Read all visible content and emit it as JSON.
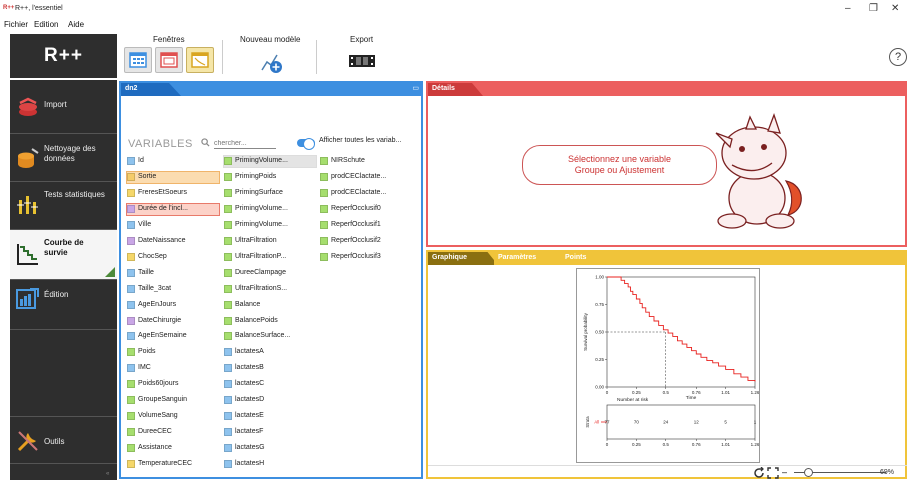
{
  "window": {
    "app_badge": "R++",
    "title": "R++, l'essentiel",
    "minimize": "–",
    "maximize": "❐",
    "close": "✕"
  },
  "menu": {
    "items": [
      "Fichier",
      "Edition",
      "Aide"
    ]
  },
  "ribbon": {
    "logo": "R++",
    "groups": {
      "fenetres": "Fenêtres",
      "nouveau_modele": "Nouveau modèle",
      "export": "Export"
    },
    "help": "?"
  },
  "sidebar": {
    "items": [
      {
        "label": "Import",
        "icon": "import-icon"
      },
      {
        "label": "Nettoyage des données",
        "icon": "cleaning-icon"
      },
      {
        "label": "Tests statistiques",
        "icon": "tests-icon"
      },
      {
        "label": "Courbe de survie",
        "icon": "survival-curve-icon",
        "active": true
      },
      {
        "label": "Édition",
        "icon": "edition-icon"
      },
      {
        "label": "Outils",
        "icon": "tools-icon"
      }
    ],
    "collapse": "«"
  },
  "dataset": {
    "tab": "dn2",
    "minimize": "▭",
    "variables_title": "VARIABLES",
    "search_placeholder": "chercher...",
    "toggle_label": "Afficher toutes les variab...",
    "columns": [
      [
        {
          "n": "Id",
          "c": "#8ec3ee"
        },
        {
          "n": "Sortie",
          "c": "#f5cc6a",
          "box": "#f0b46a"
        },
        {
          "n": "FreresEtSoeurs",
          "c": "#f5d76a"
        },
        {
          "n": "Durée de l'incl...",
          "c": "#c9a6e6",
          "box": "#e87a6a"
        },
        {
          "n": "Ville",
          "c": "#8ec3ee"
        },
        {
          "n": "DateNaissance",
          "c": "#c9a6e6"
        },
        {
          "n": "ChocSep",
          "c": "#f5d76a"
        },
        {
          "n": "Taille",
          "c": "#8ec3ee"
        },
        {
          "n": "Taille_3cat",
          "c": "#8ec3ee"
        },
        {
          "n": "AgeEnJours",
          "c": "#8ec3ee"
        },
        {
          "n": "DateChirurgie",
          "c": "#c9a6e6"
        },
        {
          "n": "AgeEnSemaine",
          "c": "#8ec3ee"
        },
        {
          "n": "Poids",
          "c": "#a6de6e"
        },
        {
          "n": "IMC",
          "c": "#8ec3ee"
        },
        {
          "n": "Poids60jours",
          "c": "#a6de6e"
        },
        {
          "n": "GroupeSanguin",
          "c": "#a6de6e"
        },
        {
          "n": "VolumeSang",
          "c": "#a6de6e"
        },
        {
          "n": "DureeCEC",
          "c": "#a6de6e"
        },
        {
          "n": "Assistance",
          "c": "#a6de6e"
        },
        {
          "n": "TemperatureCEC",
          "c": "#f5d76a"
        }
      ],
      [
        {
          "n": "PrimingVolume...",
          "c": "#a6de6e",
          "box": "#dddddd"
        },
        {
          "n": "PrimingPoids",
          "c": "#a6de6e"
        },
        {
          "n": "PrimingSurface",
          "c": "#a6de6e"
        },
        {
          "n": "PrimingVolume...",
          "c": "#a6de6e"
        },
        {
          "n": "PrimingVolume...",
          "c": "#a6de6e"
        },
        {
          "n": "UltraFiltration",
          "c": "#a6de6e"
        },
        {
          "n": "UltraFiltrationP...",
          "c": "#a6de6e"
        },
        {
          "n": "DureeClampage",
          "c": "#a6de6e"
        },
        {
          "n": "UltraFiltrationS...",
          "c": "#a6de6e"
        },
        {
          "n": "Balance",
          "c": "#a6de6e"
        },
        {
          "n": "BalancePoids",
          "c": "#a6de6e"
        },
        {
          "n": "BalanceSurface...",
          "c": "#a6de6e"
        },
        {
          "n": "lactatesA",
          "c": "#8ec3ee"
        },
        {
          "n": "lactatesB",
          "c": "#8ec3ee"
        },
        {
          "n": "lactatesC",
          "c": "#8ec3ee"
        },
        {
          "n": "lactatesD",
          "c": "#8ec3ee"
        },
        {
          "n": "lactatesE",
          "c": "#8ec3ee"
        },
        {
          "n": "lactatesF",
          "c": "#8ec3ee"
        },
        {
          "n": "lactatesG",
          "c": "#8ec3ee"
        },
        {
          "n": "lactatesH",
          "c": "#8ec3ee"
        }
      ],
      [
        {
          "n": "NIRSchute",
          "c": "#a6de6e"
        },
        {
          "n": "prodCEClactate...",
          "c": "#a6de6e"
        },
        {
          "n": "prodCEClactate...",
          "c": "#a6de6e"
        },
        {
          "n": "ReperfOcclusif0",
          "c": "#a6de6e"
        },
        {
          "n": "ReperfOcclusif1",
          "c": "#a6de6e"
        },
        {
          "n": "ReperfOcclusif2",
          "c": "#a6de6e"
        },
        {
          "n": "ReperfOcclusif3",
          "c": "#a6de6e"
        }
      ]
    ]
  },
  "details": {
    "tab": "Détails",
    "message_line1": "Sélectionnez une variable",
    "message_line2": "Groupe ou Ajustement"
  },
  "graph_panel": {
    "tabs": [
      "Graphique",
      "Paramètres",
      "Points"
    ],
    "zoom_value": "69%"
  },
  "chart_data": {
    "type": "line",
    "title": "",
    "xlabel": "Time",
    "ylabel": "Survival probability",
    "xlim": [
      0,
      1.26
    ],
    "ylim": [
      0,
      1
    ],
    "x_ticks": [
      "0",
      "0.25",
      "0.5",
      "0.76",
      "1.01",
      "1.26"
    ],
    "y_ticks": [
      "0.00",
      "0.25",
      "0.50",
      "0.75",
      "1.00"
    ],
    "median_survival": 0.5,
    "series": [
      {
        "x": [
          0,
          0.1,
          0.12,
          0.15,
          0.18,
          0.2,
          0.22,
          0.25,
          0.28,
          0.3,
          0.33,
          0.36,
          0.4,
          0.44,
          0.48,
          0.52,
          0.56,
          0.6,
          0.64,
          0.68,
          0.72,
          0.76,
          0.8,
          0.85,
          0.9,
          0.95,
          1.01,
          1.08,
          1.14,
          1.2,
          1.26
        ],
        "y": [
          1,
          1,
          0.97,
          0.94,
          0.91,
          0.87,
          0.84,
          0.8,
          0.76,
          0.72,
          0.68,
          0.64,
          0.6,
          0.56,
          0.52,
          0.49,
          0.46,
          0.42,
          0.39,
          0.36,
          0.33,
          0.3,
          0.27,
          0.24,
          0.22,
          0.19,
          0.16,
          0.12,
          0.09,
          0.06,
          0.05
        ]
      }
    ],
    "risk_table": {
      "title": "Number at risk",
      "strata_label": "Strata",
      "group": "All",
      "times": [
        "0",
        "0.25",
        "0.5",
        "0.76",
        "1.01",
        "1.26"
      ],
      "counts": [
        "77",
        "70",
        "24",
        "12",
        "5",
        "1"
      ]
    }
  }
}
